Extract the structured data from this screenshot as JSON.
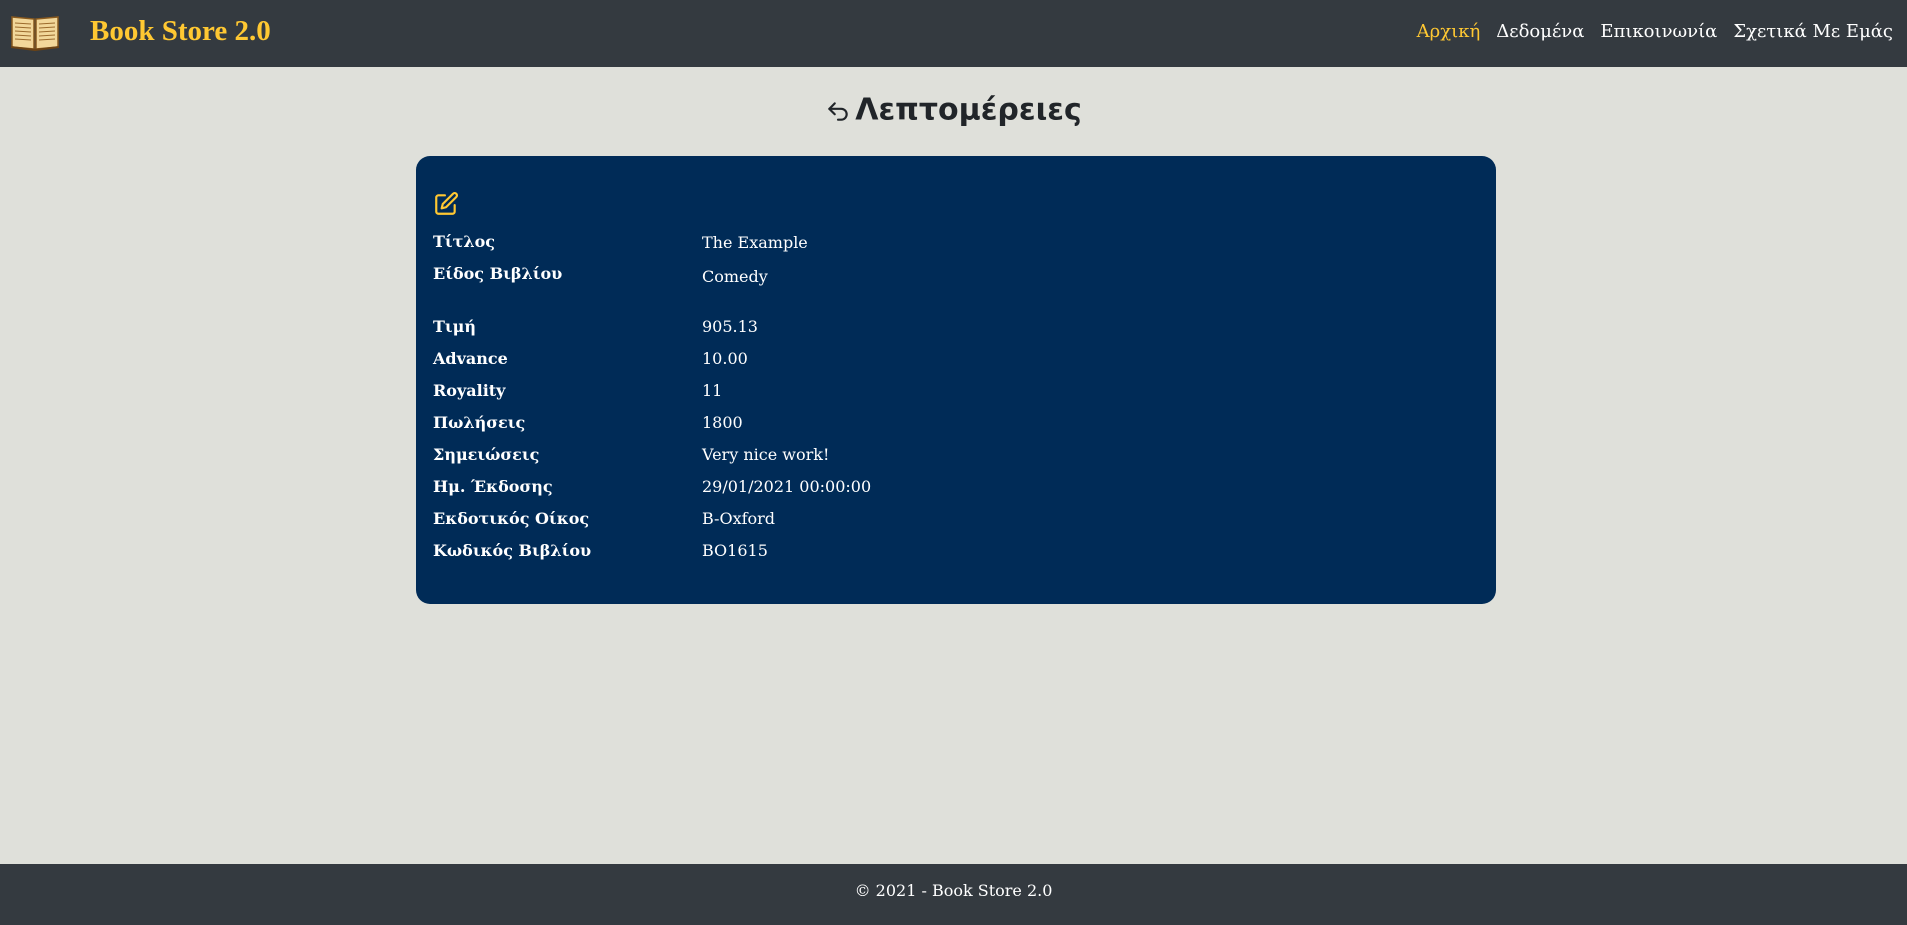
{
  "navbar": {
    "logo_icon": "open-book-icon",
    "brand": "Book Store 2.0",
    "links": [
      {
        "label": "Αρχική",
        "active": true
      },
      {
        "label": "Δεδομένα",
        "active": false
      },
      {
        "label": "Επικοινωνία",
        "active": false
      },
      {
        "label": "Σχετικά Με Εμάς",
        "active": false
      }
    ]
  },
  "page": {
    "back_icon": "back-arrow-icon",
    "title": "Λεπτομέρειες"
  },
  "card": {
    "edit_icon": "edit-icon",
    "rows": [
      {
        "label": "Τίτλος",
        "value": "The Example"
      },
      {
        "label": "Είδος Βιβλίου",
        "value": "Comedy"
      },
      {
        "label": "Τιμή",
        "value": "905.13"
      },
      {
        "label": "Advance",
        "value": "10.00"
      },
      {
        "label": "Royality",
        "value": "11"
      },
      {
        "label": "Πωλήσεις",
        "value": "1800"
      },
      {
        "label": "Σημειώσεις",
        "value": "Very nice work!"
      },
      {
        "label": "Ημ. Έκδοσης",
        "value": "29/01/2021 00:00:00"
      },
      {
        "label": "Εκδοτικός Οίκος",
        "value": "B-Oxford"
      },
      {
        "label": "Κωδικός Βιβλίου",
        "value": "BO1615"
      }
    ]
  },
  "footer": {
    "text": "© 2021 - Book Store 2.0"
  },
  "colors": {
    "navbar_bg": "#343a40",
    "accent": "#ffc832",
    "page_bg": "#dfe0da",
    "card_bg": "#002b57"
  }
}
